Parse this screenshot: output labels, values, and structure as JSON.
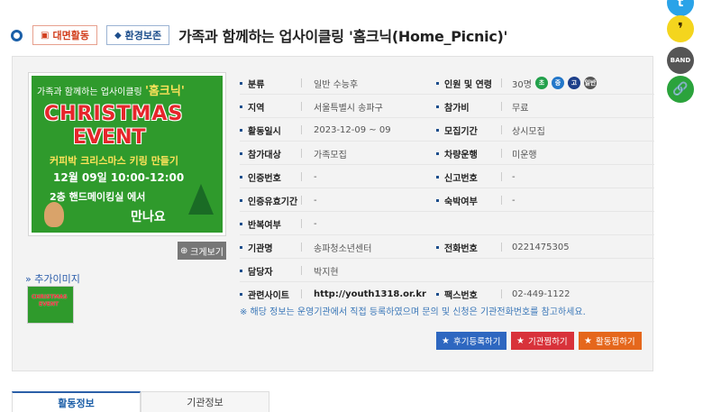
{
  "header": {
    "tag_face": "대면활동",
    "tag_env": "환경보존",
    "title": "가족과 함께하는 업사이클링 '홈크닉(Home_Picnic)'"
  },
  "social": {
    "twitter": "t",
    "kakao": "❜",
    "band": "BAND",
    "link": "🔗"
  },
  "poster": {
    "line1": "가족과 함께하는 업사이클링",
    "line1_em": "'홈크닉'",
    "xmas": "CHRISTMAS",
    "event": "EVENT",
    "sub": "커피박 크리스마스 키링 만들기",
    "date": "12월 09일 10:00-12:00",
    "place": "2층 핸드메이킹실 에서",
    "meet": "만나요"
  },
  "thumb": {
    "l1": "CHRISTMAS",
    "l2": "EVENT"
  },
  "buttons": {
    "zoom": "크게보기",
    "more_images": "추가이미지",
    "review": "후기등록하기",
    "org_fav": "기관찜하기",
    "act_fav": "활동찜하기"
  },
  "info": {
    "category_k": "분류",
    "category_v": "일반 수능후",
    "people_k": "인원 및 연령",
    "people_v": "30명",
    "ages": [
      "초",
      "중",
      "고",
      "일반"
    ],
    "region_k": "지역",
    "region_v": "서울특별시 송파구",
    "fee_k": "참가비",
    "fee_v": "무료",
    "date_k": "활동일시",
    "date_v": "2023-12-09 ~ 09",
    "recruit_k": "모집기간",
    "recruit_v": "상시모집",
    "target_k": "참가대상",
    "target_v": "가족모집",
    "vehicle_k": "차량운행",
    "vehicle_v": "미운행",
    "cert_k": "인증번호",
    "cert_v": "-",
    "report_k": "신고번호",
    "report_v": "-",
    "certvalid_k": "인증유효기간",
    "certvalid_v": "-",
    "lodging_k": "숙박여부",
    "lodging_v": "-",
    "repeat_k": "반복여부",
    "repeat_v": "-",
    "org_k": "기관명",
    "org_v": "송파청소년센터",
    "phone_k": "전화번호",
    "phone_v": "0221475305",
    "manager_k": "담당자",
    "manager_v": "박지현",
    "site_k": "관련사이트",
    "site_v": "http://youth1318.or.kr",
    "fax_k": "팩스번호",
    "fax_v": "02-449-1122"
  },
  "notice": "※ 해당 정보는 운영기관에서 직접 등록하였으며 문의 및 신청은 기관전화번호를 참고하세요.",
  "tabs": [
    "활동정보",
    "기관정보"
  ]
}
